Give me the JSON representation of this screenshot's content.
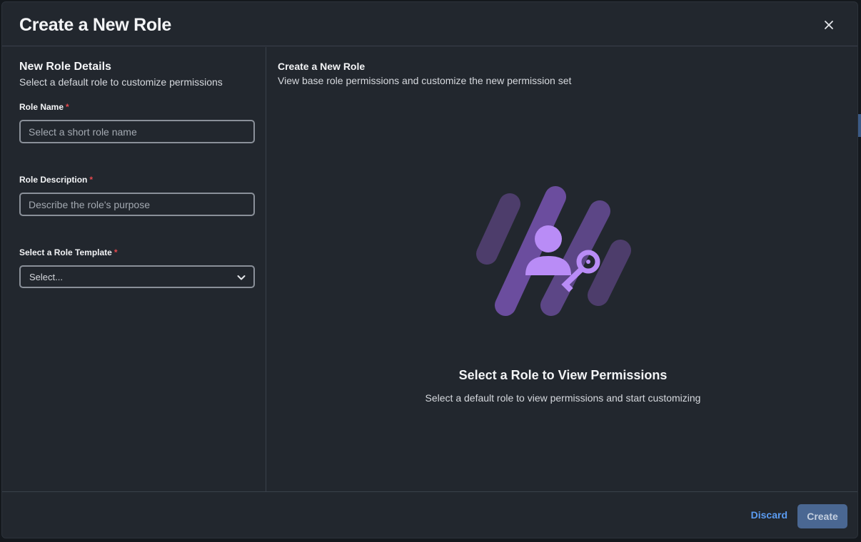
{
  "modal": {
    "title": "Create a New Role"
  },
  "left_pane": {
    "title": "New Role Details",
    "subtitle": "Select a default role to customize permissions",
    "fields": {
      "role_name": {
        "label": "Role Name",
        "required_mark": "*",
        "value": "",
        "placeholder": "Select a short role name"
      },
      "role_description": {
        "label": "Role Description",
        "required_mark": "*",
        "value": "",
        "placeholder": "Describe the role's purpose"
      },
      "role_template": {
        "label": "Select a Role Template",
        "required_mark": "*",
        "selected": "Select..."
      }
    }
  },
  "right_pane": {
    "title": "Create a New Role",
    "subtitle": "View base role permissions and customize the new permission set",
    "empty_state": {
      "title": "Select a Role to View Permissions",
      "subtitle": "Select a default role to view permissions and start customizing",
      "icon": "user-key-icon"
    }
  },
  "footer": {
    "discard_label": "Discard",
    "create_label": "Create"
  },
  "colors": {
    "modal_bg": "#22272e",
    "link": "#5b9cf2",
    "primary_disabled": "#4a6792",
    "required": "#e5484d",
    "illustration_accent": "#b98cf6"
  }
}
